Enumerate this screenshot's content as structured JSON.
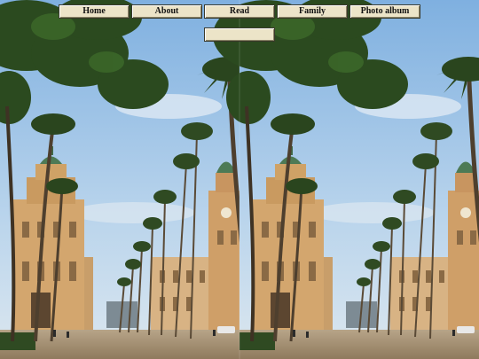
{
  "menu": {
    "items": [
      {
        "label": "Home"
      },
      {
        "label": "About"
      },
      {
        "label": "Read"
      },
      {
        "label": "Family"
      },
      {
        "label": "Photo album"
      }
    ]
  },
  "photo": {
    "description_icon": "palm-avenue-photo",
    "colors": {
      "sky": "#9ec3e6",
      "building": "#d3a66e",
      "tower_dome": "#4d7a55",
      "palm_leaf": "#2f4a22",
      "pavement": "#b9a27f"
    }
  }
}
